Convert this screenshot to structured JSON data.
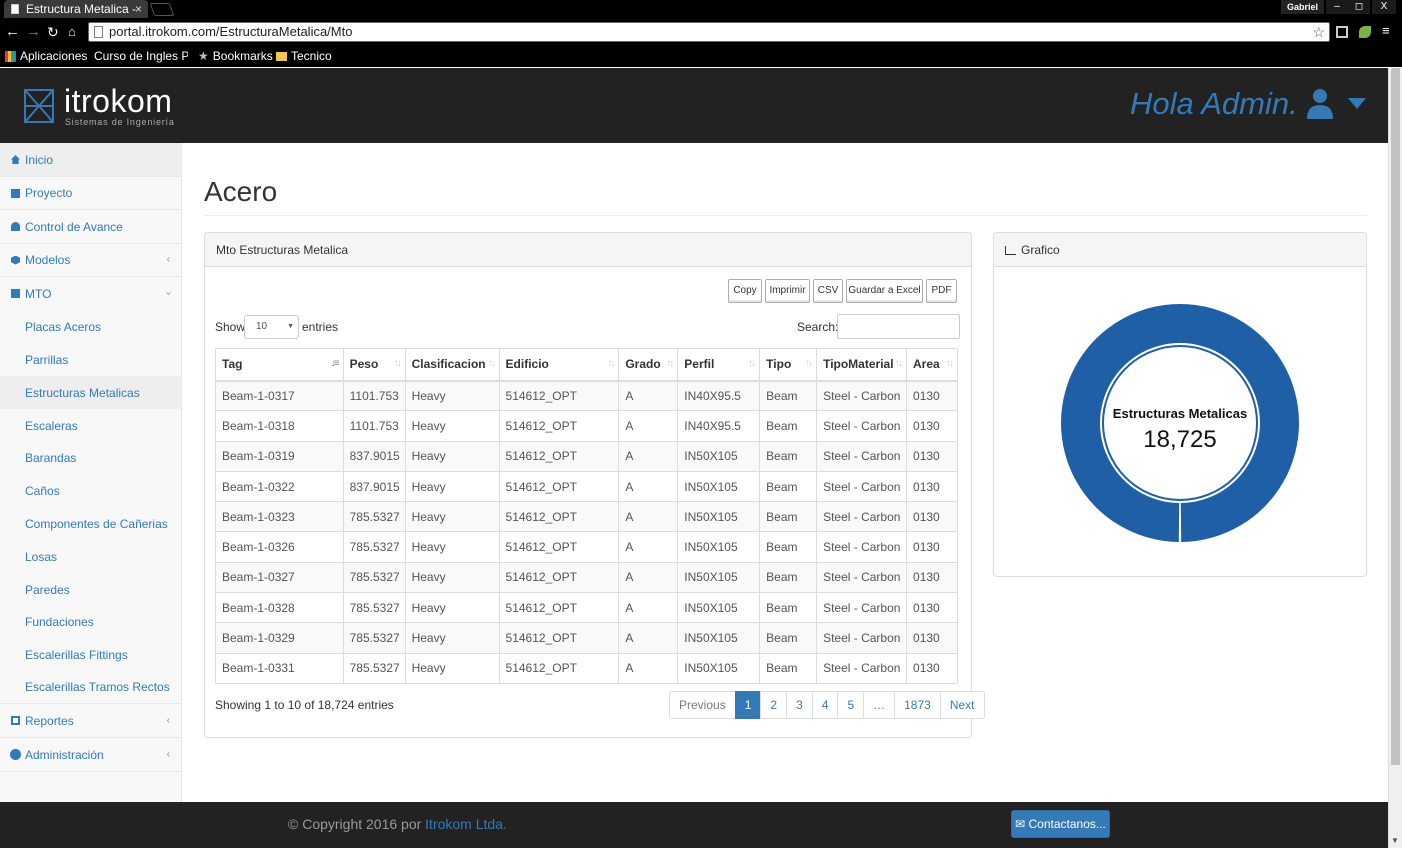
{
  "browser": {
    "tab_title": "Estructura Metalica -",
    "tab_close": "×",
    "window_user": "Gabriel",
    "window_controls": [
      "–",
      "◻",
      "X"
    ],
    "url": "portal.itrokom.com/EstructuraMetalica/Mto",
    "bookmarks": [
      "Aplicaciones",
      "Curso de Ingles P",
      "Bookmarks",
      "Tecnico"
    ]
  },
  "header": {
    "logo_text": "itrokom",
    "logo_sub": "Sistemas de Ingeniería",
    "greeting": "Hola Admin.",
    "accent_color": "#337ab7"
  },
  "sidebar": {
    "items": [
      {
        "label": "Inicio",
        "icon": "home-icon"
      },
      {
        "label": "Proyecto",
        "icon": "book-icon"
      },
      {
        "label": "Control de Avance",
        "icon": "dashboard-icon"
      },
      {
        "label": "Modelos",
        "icon": "cube-icon"
      },
      {
        "label": "MTO",
        "icon": "book-icon"
      }
    ],
    "mto_subitems": [
      "Placas Aceros",
      "Parrillas",
      "Estructuras Metalicas",
      "Escaleras",
      "Barandas",
      "Caños",
      "Componentes de Cañerias",
      "Losas",
      "Paredes",
      "Fundaciones",
      "Escalerillas Fittings",
      "Escalerillas Tramos Rectos"
    ],
    "bottom_items": [
      {
        "label": "Reportes",
        "icon": "edit-icon"
      },
      {
        "label": "Administración",
        "icon": "gear-icon"
      }
    ],
    "active_sub": "Estructuras Metalicas"
  },
  "main": {
    "title": "Acero",
    "table_panel": {
      "heading": "Mto Estructuras Metalica",
      "export_buttons": [
        "Copy",
        "Imprimir",
        "CSV",
        "Guardar a Excel",
        "PDF"
      ],
      "show_label": "Show",
      "length_value": "10",
      "entries_label": "entries",
      "search_label": "Search:",
      "columns": [
        "Tag",
        "Peso",
        "Clasificacion",
        "Edificio",
        "Grado",
        "Perfil",
        "Tipo",
        "TipoMaterial",
        "Area"
      ],
      "rows": [
        [
          "Beam-1-0317",
          "1101.753",
          "Heavy",
          "514612_OPT",
          "A",
          "IN40X95.5",
          "Beam",
          "Steel - Carbon",
          "0130"
        ],
        [
          "Beam-1-0318",
          "1101.753",
          "Heavy",
          "514612_OPT",
          "A",
          "IN40X95.5",
          "Beam",
          "Steel - Carbon",
          "0130"
        ],
        [
          "Beam-1-0319",
          "837.9015",
          "Heavy",
          "514612_OPT",
          "A",
          "IN50X105",
          "Beam",
          "Steel - Carbon",
          "0130"
        ],
        [
          "Beam-1-0322",
          "837.9015",
          "Heavy",
          "514612_OPT",
          "A",
          "IN50X105",
          "Beam",
          "Steel - Carbon",
          "0130"
        ],
        [
          "Beam-1-0323",
          "785.5327",
          "Heavy",
          "514612_OPT",
          "A",
          "IN50X105",
          "Beam",
          "Steel - Carbon",
          "0130"
        ],
        [
          "Beam-1-0326",
          "785.5327",
          "Heavy",
          "514612_OPT",
          "A",
          "IN50X105",
          "Beam",
          "Steel - Carbon",
          "0130"
        ],
        [
          "Beam-1-0327",
          "785.5327",
          "Heavy",
          "514612_OPT",
          "A",
          "IN50X105",
          "Beam",
          "Steel - Carbon",
          "0130"
        ],
        [
          "Beam-1-0328",
          "785.5327",
          "Heavy",
          "514612_OPT",
          "A",
          "IN50X105",
          "Beam",
          "Steel - Carbon",
          "0130"
        ],
        [
          "Beam-1-0329",
          "785.5327",
          "Heavy",
          "514612_OPT",
          "A",
          "IN50X105",
          "Beam",
          "Steel - Carbon",
          "0130"
        ],
        [
          "Beam-1-0331",
          "785.5327",
          "Heavy",
          "514612_OPT",
          "A",
          "IN50X105",
          "Beam",
          "Steel - Carbon",
          "0130"
        ]
      ],
      "info": "Showing 1 to 10 of 18,724 entries",
      "pagination": [
        "Previous",
        "1",
        "2",
        "3",
        "4",
        "5",
        "…",
        "1873",
        "Next"
      ],
      "current_page": "1"
    },
    "chart_panel": {
      "heading": "Grafico",
      "center_label": "Estructuras Metalicas",
      "center_value": "18,725",
      "ring_color": "#1f5fa5"
    }
  },
  "footer": {
    "copyright": "© Copyright 2016 por ",
    "company": "Itrokom Ltda.",
    "contact": "Contactanos..."
  },
  "chart_data": {
    "type": "pie",
    "labels": [
      "Estructuras Metalicas"
    ],
    "values": [
      18725
    ],
    "title": "",
    "colors": [
      "#1f5fa5"
    ]
  }
}
